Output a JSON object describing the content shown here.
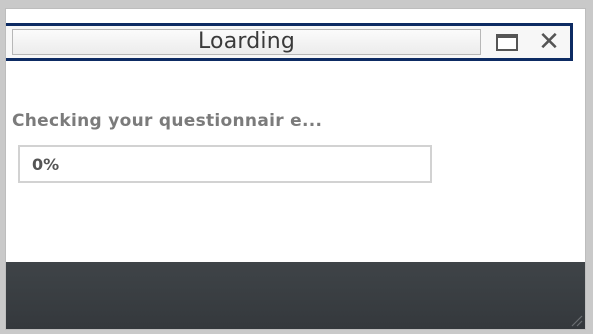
{
  "window": {
    "title": "Loarding",
    "maximize_icon": "maximize-icon",
    "close_icon": "close-icon",
    "close_glyph": "✕"
  },
  "content": {
    "status_text": "Checking your questionnair e...",
    "progress_percent": 0,
    "progress_label": "0%"
  },
  "colors": {
    "title_frame": "#0d2b63",
    "footer": "#3a3e42",
    "status_text": "#7b7b7b"
  }
}
